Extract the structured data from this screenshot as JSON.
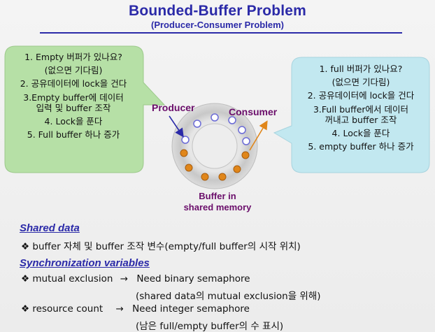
{
  "header": {
    "title": "Bounded-Buffer Problem",
    "subtitle": "(Producer-Consumer Problem)"
  },
  "producer_bubble": {
    "lines": [
      "1. Empty 버퍼가 있나요?",
      "(없으면 기다림)",
      "2. 공유데이터에 lock을 건다",
      "3.Empty buffer에 데이터",
      "입력 및 buffer 조작",
      "4. Lock을 푼다",
      "5. Full buffer 하나 증가"
    ]
  },
  "consumer_bubble": {
    "lines": [
      "1. full 버퍼가 있나요?",
      "(없으면 기다림)",
      "2. 공유데이터에 lock을 건다",
      "3.Full buffer에서 데이터",
      "꺼내고 buffer 조작",
      "4. Lock을 푼다",
      "5. empty buffer 하나 증가"
    ]
  },
  "diagram": {
    "producer_label": "Producer",
    "consumer_label": "Consumer",
    "buffer_label_1": "Buffer in",
    "buffer_label_2": "shared memory",
    "empty_slots": 6,
    "full_slots": 6,
    "colors": {
      "bubble_green": "#b6e0a6",
      "bubble_blue": "#c2e8f0",
      "ring": "#cfcfcf",
      "empty_slot": "#6b6bd6",
      "full_slot": "#e0861a",
      "label": "#6a0d6a",
      "heading": "#2b2aa8"
    }
  },
  "shared_data": {
    "heading": "Shared data",
    "item": "❖ buffer 자체 및 buffer 조작 변수(empty/full buffer의 시작 위치)"
  },
  "sync": {
    "heading": "Synchronization variables",
    "mutual_left": "❖ mutual exclusion",
    "arrow": "→",
    "mutual_right": "Need binary semaphore",
    "mutual_note": "(shared data의 mutual exclusion을 위해)",
    "resource_left": "❖ resource count",
    "resource_right": "Need integer semaphore",
    "resource_note": "(남은 full/empty buffer의 수 표시)"
  }
}
